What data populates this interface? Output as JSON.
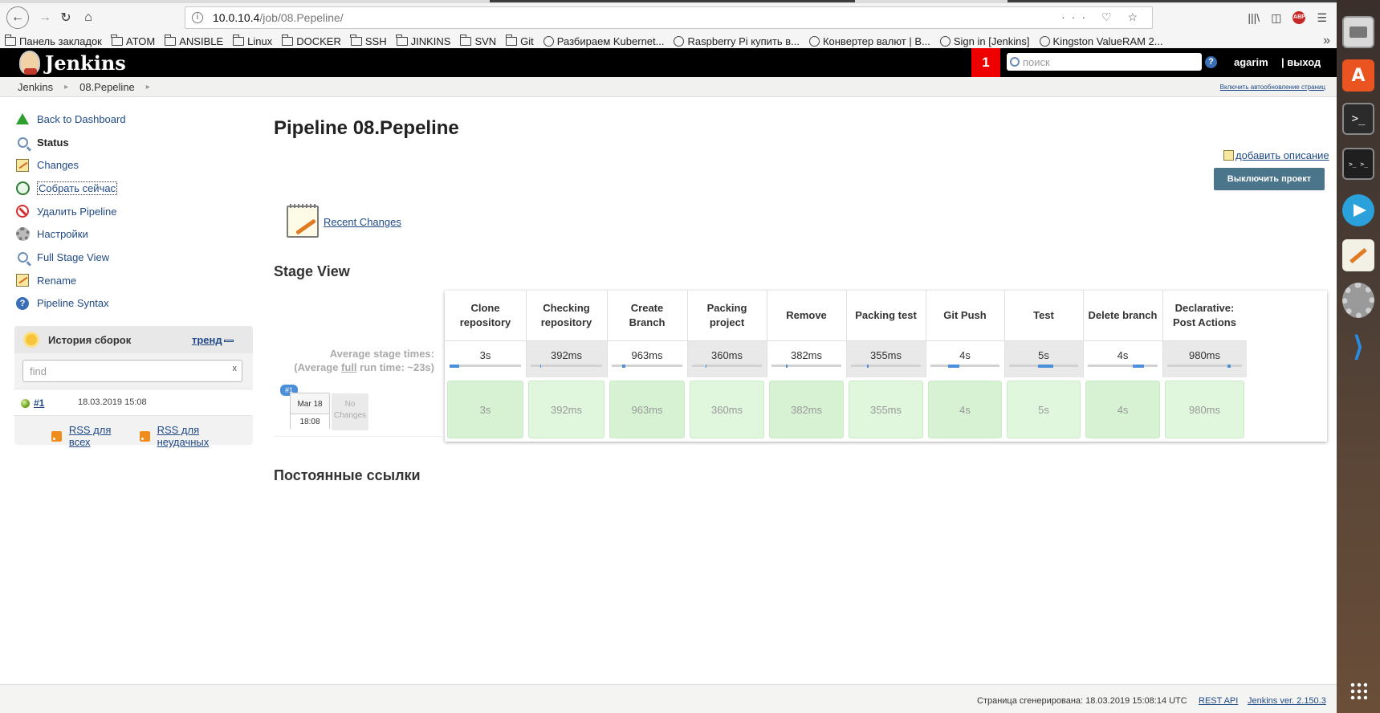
{
  "browser": {
    "url_host": "10.0.10.4",
    "url_path": "/job/08.Pepeline/",
    "url_actions": "··· ♡ ☆"
  },
  "bookmarks": [
    {
      "label": "Панель закладок",
      "icon": "folder-icon"
    },
    {
      "label": "ATOM",
      "icon": "folder-icon"
    },
    {
      "label": "ANSIBLE",
      "icon": "folder-icon"
    },
    {
      "label": "Linux",
      "icon": "folder-icon"
    },
    {
      "label": "DOCKER",
      "icon": "folder-icon"
    },
    {
      "label": "SSH",
      "icon": "folder-icon"
    },
    {
      "label": "JINKINS",
      "icon": "folder-icon"
    },
    {
      "label": "SVN",
      "icon": "folder-icon"
    },
    {
      "label": "Git",
      "icon": "folder-icon"
    },
    {
      "label": "Разбираем Kubernet...",
      "icon": "globe-icon"
    },
    {
      "label": "Raspberry Pi купить в...",
      "icon": "globe-icon"
    },
    {
      "label": "Конвертер валют | В...",
      "icon": "globe-icon"
    },
    {
      "label": "Sign in [Jenkins]",
      "icon": "globe-icon"
    },
    {
      "label": "Kingston ValueRAM 2...",
      "icon": "globe-icon"
    }
  ],
  "header": {
    "title": "Jenkins",
    "notification_count": "1",
    "search_placeholder": "поиск",
    "help": "?",
    "user": "agarim",
    "logout": "| выход"
  },
  "breadcrumb": {
    "items": [
      "Jenkins",
      "08.Pepeline"
    ],
    "auto_refresh": "Включить автообновление страниц"
  },
  "sidebar": {
    "items": [
      {
        "label": "Back to Dashboard",
        "icon": "arrow-up-icon"
      },
      {
        "label": "Status",
        "icon": "magnifier-icon"
      },
      {
        "label": "Changes",
        "icon": "notepad-icon"
      },
      {
        "label": "Собрать сейчас",
        "icon": "build-icon"
      },
      {
        "label": "Удалить Pipeline",
        "icon": "delete-icon"
      },
      {
        "label": "Настройки",
        "icon": "gear-icon"
      },
      {
        "label": "Full Stage View",
        "icon": "magnifier-icon"
      },
      {
        "label": "Rename",
        "icon": "notepad-icon"
      },
      {
        "label": "Pipeline Syntax",
        "icon": "help-icon"
      }
    ]
  },
  "history": {
    "title": "История сборок",
    "trend": "тренд",
    "find_placeholder": "find",
    "clear": "x",
    "build_number": "#1",
    "build_date": "18.03.2019 15:08",
    "rss_all": "RSS для всех",
    "rss_failed": "RSS для неудачных"
  },
  "main": {
    "title": "Pipeline 08.Pepeline",
    "add_description": "добавить описание",
    "disable_project": "Выключить проект",
    "recent_changes": "Recent Changes",
    "stage_view_title": "Stage View",
    "avg_stage_times": "Average stage times:",
    "avg_full_prefix": "(Average ",
    "avg_full_word": "full",
    "avg_full_suffix": " run time: ~23s)",
    "permalinks_title": "Постоянные ссылки"
  },
  "build": {
    "tag": "#1",
    "date": "Mar 18",
    "time": "18:08",
    "no_changes": "No Changes"
  },
  "stages": [
    {
      "name": "Clone repository",
      "avg": "3s",
      "run": "3s",
      "avg_bar_fraction": 0.13
    },
    {
      "name": "Checking repository",
      "avg": "392ms",
      "run": "392ms",
      "avg_bar_fraction": 0.02
    },
    {
      "name": "Create Branch",
      "avg": "963ms",
      "run": "963ms",
      "avg_bar_fraction": 0.04
    },
    {
      "name": "Packing project",
      "avg": "360ms",
      "run": "360ms",
      "avg_bar_fraction": 0.02
    },
    {
      "name": "Remove",
      "avg": "382ms",
      "run": "382ms",
      "avg_bar_fraction": 0.02
    },
    {
      "name": "Packing test",
      "avg": "355ms",
      "run": "355ms",
      "avg_bar_fraction": 0.02
    },
    {
      "name": "Git Push",
      "avg": "4s",
      "run": "4s",
      "avg_bar_fraction": 0.17
    },
    {
      "name": "Test",
      "avg": "5s",
      "run": "5s",
      "avg_bar_fraction": 0.22
    },
    {
      "name": "Delete branch",
      "avg": "4s",
      "run": "4s",
      "avg_bar_fraction": 0.17
    },
    {
      "name": "Declarative: Post Actions",
      "avg": "980ms",
      "run": "980ms",
      "avg_bar_fraction": 0.04
    }
  ],
  "footer": {
    "generated": "Страница сгенерирована: 18.03.2019 15:08:14 UTC",
    "rest_api": "REST API",
    "version": "Jenkins ver. 2.150.3"
  },
  "launcher": [
    "files-icon",
    "software-center-icon",
    "terminal-icon",
    "terminator-icon",
    "telegram-icon",
    "text-editor-icon",
    "settings-icon",
    "vscode-icon",
    "apps-grid-icon"
  ]
}
